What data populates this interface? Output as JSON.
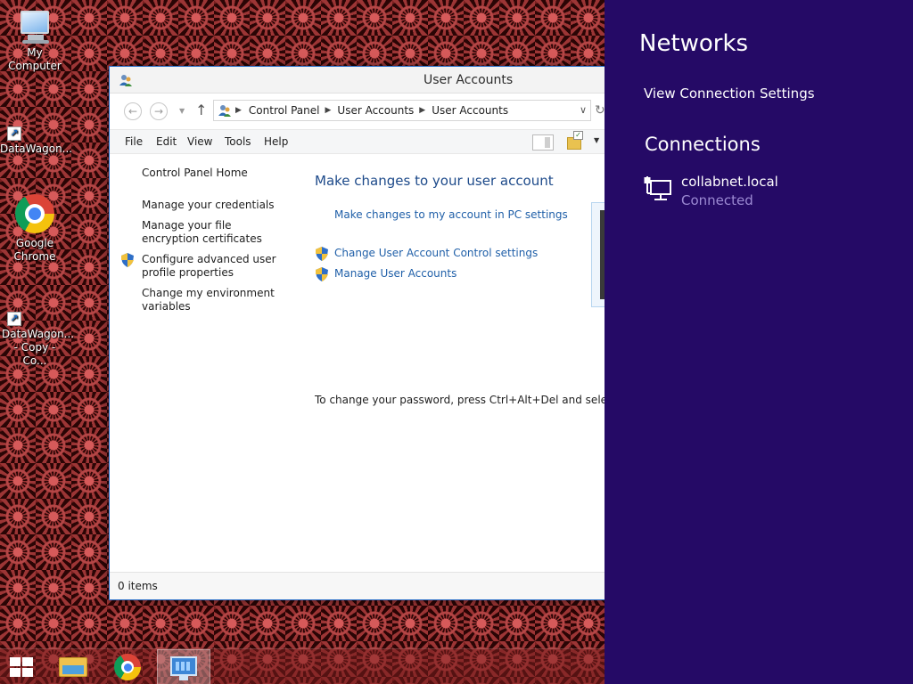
{
  "desktop": {
    "icons": [
      {
        "label": "My Computer"
      },
      {
        "label": "DataWagon..."
      },
      {
        "label": "Google Chrome"
      },
      {
        "label": "DataWagon... - Copy - Co..."
      }
    ]
  },
  "window": {
    "title": "User Accounts",
    "breadcrumbs": [
      "Control Panel",
      "User Accounts",
      "User Accounts"
    ],
    "menu": [
      "File",
      "Edit",
      "View",
      "Tools",
      "Help"
    ],
    "left_nav": {
      "home": "Control Panel Home",
      "links": [
        "Manage your credentials",
        "Manage your file encryption certificates",
        "Configure advanced user profile properties",
        "Change my environment variables"
      ]
    },
    "main": {
      "heading": "Make changes to your user account",
      "links": [
        "Make changes to my account in PC settings",
        "Change User Account Control settings",
        "Manage User Accounts"
      ],
      "note": "To change your password, press Ctrl+Alt+Del and select Chan"
    },
    "status": "0 items"
  },
  "taskbar": {
    "items": [
      "start-button",
      "file-explorer",
      "google-chrome",
      "control-panel"
    ]
  },
  "networks": {
    "title": "Networks",
    "view_settings": "View Connection Settings",
    "connections_title": "Connections",
    "connection": {
      "name": "collabnet.local",
      "status": "Connected"
    }
  },
  "colors": {
    "charm_background": "#250a66",
    "link_blue": "#1f5fa8",
    "heading_blue": "#1d4a8a",
    "connected_status": "#9c8ad3"
  }
}
